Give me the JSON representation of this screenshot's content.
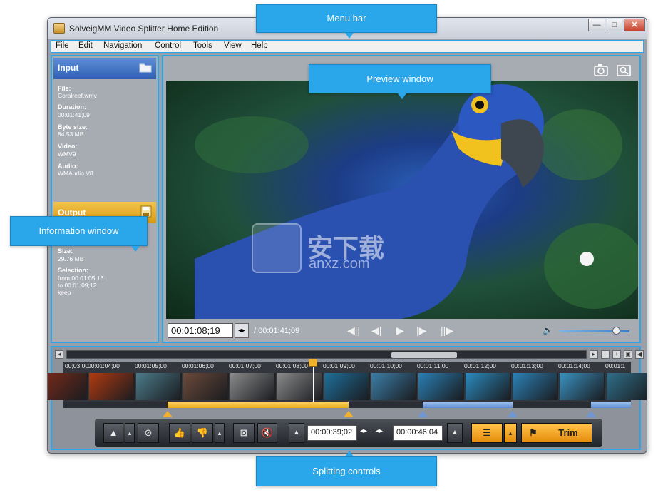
{
  "window": {
    "title": "SolveigMM Video Splitter Home Edition",
    "min_label": "—",
    "max_label": "□",
    "close_label": "✕"
  },
  "menu": [
    {
      "label": "File"
    },
    {
      "label": "Edit"
    },
    {
      "label": "Navigation"
    },
    {
      "label": "Control"
    },
    {
      "label": "Tools"
    },
    {
      "label": "View"
    },
    {
      "label": "Help"
    }
  ],
  "input_panel": {
    "title": "Input",
    "fields": [
      {
        "label": "File:",
        "value": "Coralreef.wmv"
      },
      {
        "label": "Duration:",
        "value": "00:01:41;09"
      },
      {
        "label": "Byte size:",
        "value": "84.53 MB"
      },
      {
        "label": "Video:",
        "value": "WMV9"
      },
      {
        "label": "Audio:",
        "value": "WMAudio V8"
      }
    ]
  },
  "output_panel": {
    "title": "Output",
    "size_label": "Size:",
    "size_value": "29.76 MB",
    "selection_label": "Selection:",
    "from_line": "from  00:01:05;16",
    "to_line": "to      00:01:09;12",
    "keep": "keep"
  },
  "preview": {
    "current_time": "00:01:08;19",
    "total_time": "/ 00:01:41;09",
    "watermark": "安下载",
    "watermark_sub": "anxz.com"
  },
  "timeline": {
    "ticks": [
      "00;03;00",
      "00:01:04;00",
      "00:01:05;00",
      "00:01:06;00",
      "00:01:07;00",
      "00:01:08;00",
      "00:01:09;00",
      "00:01:10;00",
      "00:01:11;00",
      "00:01:12;00",
      "00:01:13;00",
      "00:01:14;00",
      "00:01:1"
    ],
    "frame_colors": [
      "#7a2a18",
      "#b13a10",
      "#4c7b8a",
      "#6c4a3a",
      "#8a8a8a",
      "#8a8a8a",
      "#1e6f9a",
      "#3c7ea8",
      "#2a7fb4",
      "#2b8bc0",
      "#2c82b8",
      "#3a92c2",
      "#2f6f8a"
    ]
  },
  "bottom_controls": {
    "start_time": "00:00:39;02",
    "end_time": "00:00:46;04",
    "trim_label": "Trim"
  },
  "callouts": {
    "menu_bar": "Menu bar",
    "preview_window": "Preview window",
    "information_window": "Information window",
    "splitting_controls": "Splitting controls"
  },
  "colors": {
    "accent": "#2aa6ea",
    "selection": "#f2c030",
    "trim": "#f3a21a"
  }
}
